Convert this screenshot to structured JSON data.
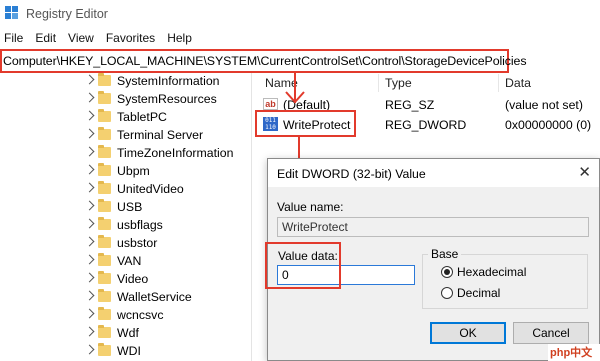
{
  "window": {
    "title": "Registry Editor"
  },
  "menu": [
    "File",
    "Edit",
    "View",
    "Favorites",
    "Help"
  ],
  "address": {
    "path": "Computer\\HKEY_LOCAL_MACHINE\\SYSTEM\\CurrentControlSet\\Control\\StorageDevicePolicies"
  },
  "tree": {
    "items": [
      "SystemInformation",
      "SystemResources",
      "TabletPC",
      "Terminal Server",
      "TimeZoneInformation",
      "Ubpm",
      "UnitedVideo",
      "USB",
      "usbflags",
      "usbstor",
      "VAN",
      "Video",
      "WalletService",
      "wcncsvc",
      "Wdf",
      "WDI"
    ]
  },
  "list": {
    "headers": {
      "name": "Name",
      "type": "Type",
      "data": "Data"
    },
    "rows": [
      {
        "name": "(Default)",
        "type": "REG_SZ",
        "data": "(value not set)",
        "icon": "string-value-icon"
      },
      {
        "name": "WriteProtect",
        "type": "REG_DWORD",
        "data": "0x00000000 (0)",
        "icon": "binary-value-icon"
      }
    ]
  },
  "dialog": {
    "title": "Edit DWORD (32-bit) Value",
    "value_name_label": "Value name:",
    "value_name": "WriteProtect",
    "value_data_label": "Value data:",
    "value_data": "0",
    "base_label": "Base",
    "base_options": [
      "Hexadecimal",
      "Decimal"
    ],
    "base_selected": "Hexadecimal",
    "ok_label": "OK",
    "cancel_label": "Cancel",
    "close_glyph": "✕"
  },
  "icons": {
    "ab_glyph": "ab",
    "bin_glyph": "011 110"
  },
  "watermark": "php中文网",
  "colors": {
    "annotation": "#e23a2c",
    "accent": "#0078d7",
    "folder": "#f4d070"
  }
}
